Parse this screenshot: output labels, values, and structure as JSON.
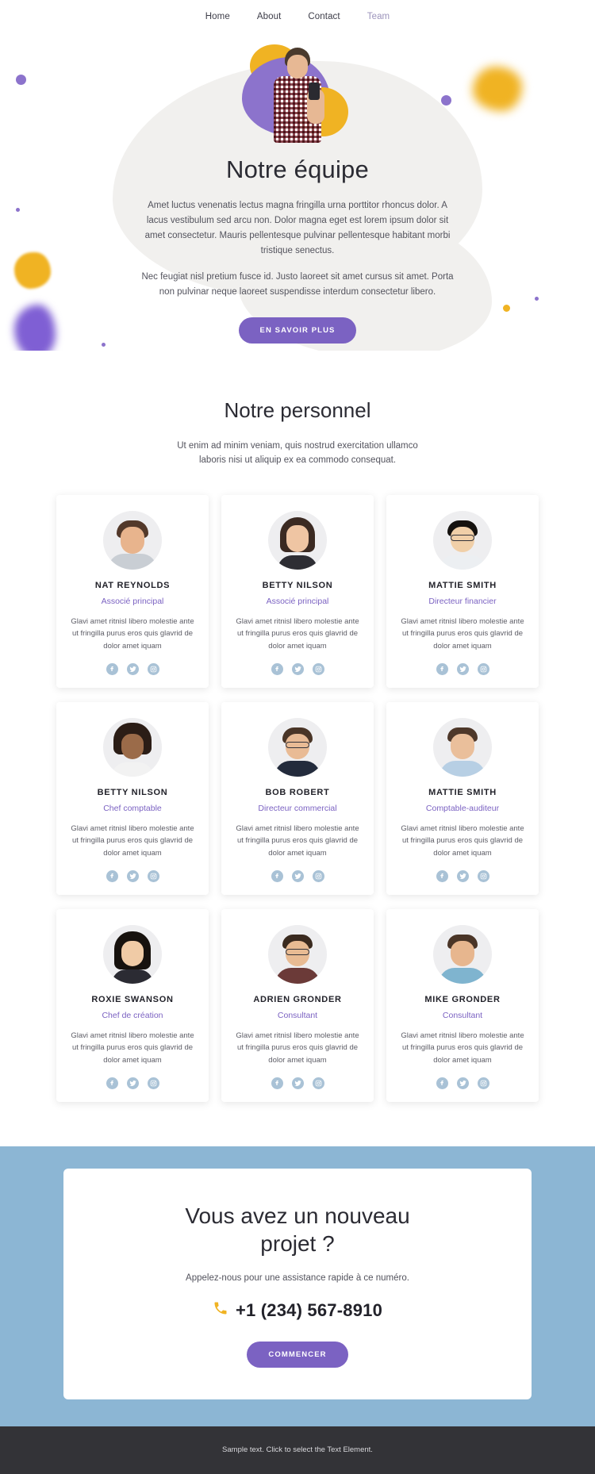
{
  "nav": {
    "items": [
      {
        "label": "Home",
        "active": false
      },
      {
        "label": "About",
        "active": false
      },
      {
        "label": "Contact",
        "active": false
      },
      {
        "label": "Team",
        "active": true
      }
    ]
  },
  "hero": {
    "title": "Notre équipe",
    "paragraph1": "Amet luctus venenatis lectus magna fringilla urna porttitor rhoncus dolor. A lacus vestibulum sed arcu non. Dolor magna eget est lorem ipsum dolor sit amet consectetur. Mauris pellentesque pulvinar pellentesque habitant morbi tristique senectus.",
    "paragraph2": "Nec feugiat nisl pretium fusce id. Justo laoreet sit amet cursus sit amet. Porta non pulvinar neque laoreet suspendisse interdum consectetur libero.",
    "cta_label": "EN SAVOIR PLUS"
  },
  "team": {
    "title": "Notre personnel",
    "subtitle": "Ut enim ad minim veniam, quis nostrud exercitation ullamco laboris nisi ut aliquip ex ea commodo consequat.",
    "description": "Glavi amet ritnisl libero molestie ante ut fringilla purus eros quis glavrid de dolor amet iquam",
    "social_icons": [
      "facebook-icon",
      "twitter-icon",
      "instagram-icon"
    ],
    "members": [
      {
        "name": "NAT REYNOLDS",
        "role": "Associé principal",
        "desc": "Glavi amet ritnisl libero molestie ante ut fringilla purus eros quis glavrid de dolor amet iquam"
      },
      {
        "name": "BETTY NILSON",
        "role": "Associé principal",
        "desc": "Glavi amet ritnisl libero molestie ante ut fringilla purus eros quis glavrid de dolor amet iquam"
      },
      {
        "name": "MATTIE SMITH",
        "role": "Directeur financier",
        "desc": "Glavi amet ritnisl libero molestie ante ut fringilla purus eros quis glavrid de dolor amet iquam"
      },
      {
        "name": "BETTY NILSON",
        "role": "Chef comptable",
        "desc": "Glavi amet ritnisl libero molestie ante ut fringilla purus eros quis glavrid de dolor amet iquam"
      },
      {
        "name": "BOB ROBERT",
        "role": "Directeur commercial",
        "desc": "Glavi amet ritnisl libero molestie ante ut fringilla purus eros quis glavrid de dolor amet iquam"
      },
      {
        "name": "MATTIE SMITH",
        "role": "Comptable-auditeur",
        "desc": "Glavi amet ritnisl libero molestie ante ut fringilla purus eros quis glavrid de dolor amet iquam"
      },
      {
        "name": "ROXIE SWANSON",
        "role": "Chef de création",
        "desc": "Glavi amet ritnisl libero molestie ante ut fringilla purus eros quis glavrid de dolor amet iquam"
      },
      {
        "name": "ADRIEN GRONDER",
        "role": "Consultant",
        "desc": "Glavi amet ritnisl libero molestie ante ut fringilla purus eros quis glavrid de dolor amet iquam"
      },
      {
        "name": "MIKE GRONDER",
        "role": "Consultant",
        "desc": "Glavi amet ritnisl libero molestie ante ut fringilla purus eros quis glavrid de dolor amet iquam"
      }
    ]
  },
  "cta": {
    "title": "Vous avez un nouveau projet ?",
    "subtitle": "Appelez-nous pour une assistance rapide à ce numéro.",
    "phone": "+1 (234) 567-8910",
    "phone_icon": "phone-icon",
    "button_label": "COMMENCER"
  },
  "footer": {
    "text": "Sample text. Click to select the Text Element."
  },
  "colors": {
    "accent_purple": "#7b62c2",
    "accent_yellow": "#f0b323",
    "cta_band_blue": "#8cb6d4",
    "footer_dark": "#333337",
    "social_blue": "#a9c2d6",
    "hero_blob_gray": "#f1f0ee"
  }
}
